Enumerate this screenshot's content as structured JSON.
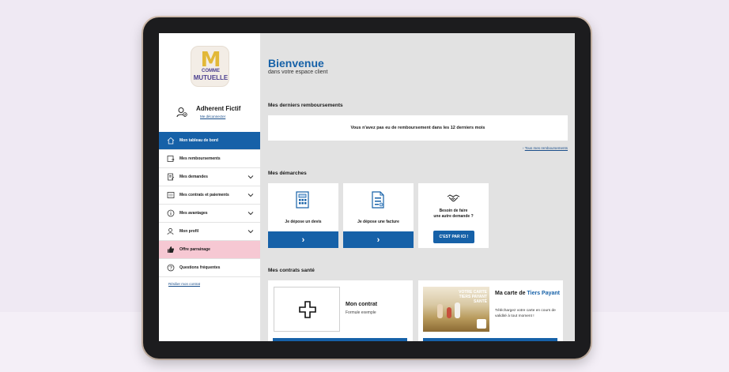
{
  "brand": {
    "logo_text_top": "COMME",
    "logo_text_bottom": "MUTUELLE",
    "accent_color": "#1661a8",
    "pink_color": "#f6c8d3"
  },
  "user": {
    "name": "Adherent Fictif",
    "logout_label": "Me déconnecter"
  },
  "sidebar": {
    "items": [
      {
        "label": "Mon tableau de bord",
        "icon": "home-icon",
        "active": true
      },
      {
        "label": "Mes remboursements",
        "icon": "refund-icon"
      },
      {
        "label": "Mes demandes",
        "icon": "request-icon",
        "expandable": true
      },
      {
        "label": "Mes contrats et paiements",
        "icon": "contract-icon",
        "expandable": true
      },
      {
        "label": "Mes avantages",
        "icon": "info-icon",
        "expandable": true
      },
      {
        "label": "Mon profil",
        "icon": "profile-icon",
        "expandable": true
      },
      {
        "label": "Offre parrainage",
        "icon": "thumbs-up-icon",
        "highlight": true
      },
      {
        "label": "Questions fréquentes",
        "icon": "question-icon"
      }
    ],
    "resilier_label": "Résilier mon contrat"
  },
  "welcome": {
    "title": "Bienvenue",
    "subtitle": "dans votre espace client"
  },
  "remboursements": {
    "section_title": "Mes derniers remboursements",
    "empty_message": "Vous n'avez pas eu de remboursement dans les 12 derniers mois",
    "all_link": "Tous mes remboursements"
  },
  "demarches": {
    "section_title": "Mes démarches",
    "cards": [
      {
        "label": "Je dépose un devis",
        "icon": "calculator-document-icon"
      },
      {
        "label": "Je dépose une facture",
        "icon": "invoice-icon"
      },
      {
        "label_line1": "Besoin de faire",
        "label_line2": "une autre demande ?",
        "button": "C'EST PAR ICI !",
        "icon": "handshake-icon"
      }
    ]
  },
  "contrats": {
    "section_title": "Mes contrats santé",
    "contract_title": "Mon contrat",
    "contract_sub": "Formule exemple",
    "tp_photo_text": "VOTRE CARTE TIERS PAYANT SANTÉ",
    "tp_title_prefix": "Ma carte de",
    "tp_title_highlight": "Tiers Payant",
    "tp_desc": "Téléchargez votre carte en cours de validité à tout moment !"
  }
}
